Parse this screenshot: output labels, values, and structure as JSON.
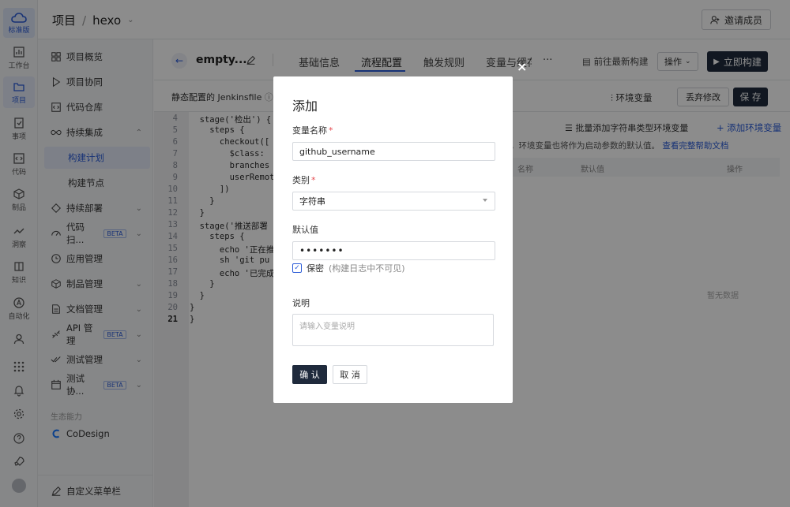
{
  "rail": {
    "logo_label": "标准版",
    "items": [
      {
        "label": "工作台",
        "icon": "chart-icon"
      },
      {
        "label": "项目",
        "icon": "project-icon"
      },
      {
        "label": "事项",
        "icon": "issue-icon"
      },
      {
        "label": "代码",
        "icon": "code-icon"
      },
      {
        "label": "制品",
        "icon": "package-icon"
      },
      {
        "label": "洞察",
        "icon": "insight-icon"
      },
      {
        "label": "知识",
        "icon": "book-icon"
      },
      {
        "label": "自动化",
        "icon": "automation-icon"
      }
    ]
  },
  "header": {
    "breadcrumb_root": "项目",
    "separator": "/",
    "project": "hexo",
    "invite_label": "邀请成员"
  },
  "sidebar": {
    "items": [
      {
        "label": "项目概览"
      },
      {
        "label": "项目协同"
      },
      {
        "label": "代码仓库"
      },
      {
        "label": "持续集成"
      },
      {
        "label": "构建计划"
      },
      {
        "label": "构建节点"
      },
      {
        "label": "持续部署"
      },
      {
        "label": "代码扫..."
      },
      {
        "label": "应用管理"
      },
      {
        "label": "制品管理"
      },
      {
        "label": "文档管理"
      },
      {
        "label": "API 管理"
      },
      {
        "label": "测试管理"
      },
      {
        "label": "测试协..."
      }
    ],
    "beta": "BETA",
    "section_title": "生态能力",
    "codesign": "CoDesign",
    "custom_menu": "自定义菜单栏"
  },
  "tabsbar": {
    "pipeline_name": "empty...",
    "tabs": [
      "基础信息",
      "流程配置",
      "触发规则",
      "变量与缓存"
    ],
    "more": "···",
    "latest_build": "前往最新构建",
    "ops_label": "操作",
    "run_label": "立即构建"
  },
  "toolbar2": {
    "jenkinsfile_label": "静态配置的 Jenkinsfile",
    "envvar_label": "环境变量",
    "discard_label": "丢弃修改",
    "save_label": "保 存"
  },
  "editor": {
    "lines": [
      {
        "n": "4",
        "t": "  stage('检出') {"
      },
      {
        "n": "5",
        "t": "    steps {"
      },
      {
        "n": "6",
        "t": "      checkout(["
      },
      {
        "n": "7",
        "t": "        $class: "
      },
      {
        "n": "8",
        "t": "        branches"
      },
      {
        "n": "9",
        "t": "        userRemot"
      },
      {
        "n": "10",
        "t": "      ])"
      },
      {
        "n": "11",
        "t": "    }"
      },
      {
        "n": "12",
        "t": "  }"
      },
      {
        "n": "13",
        "t": "  stage('推送部署"
      },
      {
        "n": "14",
        "t": "    steps {"
      },
      {
        "n": "15",
        "t": "      echo '正在推"
      },
      {
        "n": "16",
        "t": "      sh 'git pu"
      },
      {
        "n": "17",
        "t": "      echo '已完成"
      },
      {
        "n": "18",
        "t": "    }"
      },
      {
        "n": "19",
        "t": "  }"
      },
      {
        "n": "20",
        "t": "}"
      },
      {
        "n": "21",
        "t": "}"
      }
    ]
  },
  "env_panel": {
    "batch_add": "批量添加字符串类型环境变量",
    "add": "+ 添加环境变量",
    "hint_text": "务时，环境变量也将作为启动参数的默认值。",
    "hint_link": "查看完整帮助文档",
    "col_name": "名称",
    "col_default": "默认值",
    "col_ops": "操作",
    "empty": "暂无数据"
  },
  "modal": {
    "title": "添加",
    "name_label": "变量名称",
    "name_value": "github_username",
    "type_label": "类别",
    "type_value": "字符串",
    "default_label": "默认值",
    "default_value": "•••••••",
    "secret_label": "保密",
    "secret_hint": "(构建日志中不可见)",
    "desc_label": "说明",
    "desc_placeholder": "请输入变量说明",
    "confirm": "确 认",
    "cancel": "取 消",
    "required_mark": "*",
    "close_glyph": "×"
  }
}
